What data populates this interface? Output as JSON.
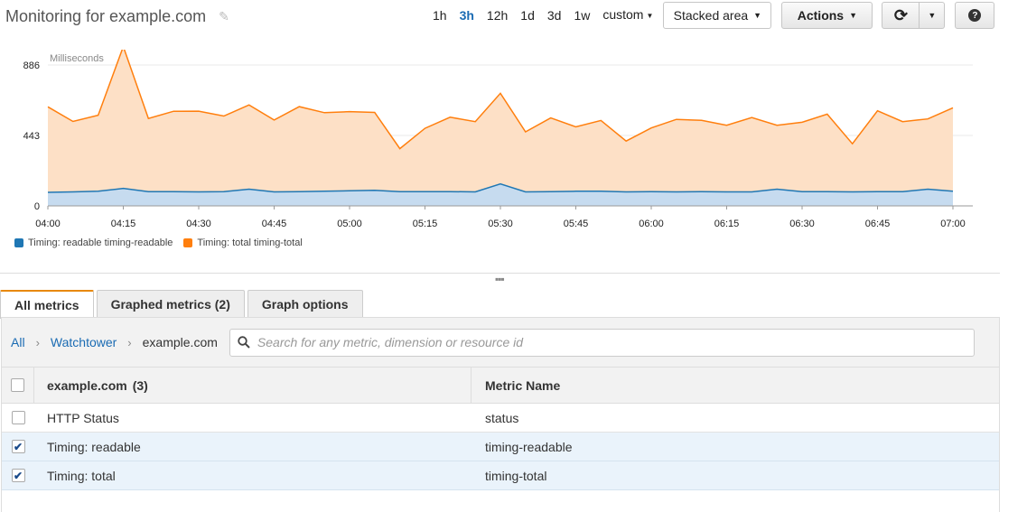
{
  "header": {
    "title": "Monitoring for example.com",
    "ranges": [
      "1h",
      "3h",
      "12h",
      "1d",
      "3d",
      "1w"
    ],
    "active_range": "3h",
    "custom_label": "custom",
    "chart_type_label": "Stacked area",
    "actions_label": "Actions",
    "icons": {
      "edit": "pencil-icon",
      "refresh": "refresh-icon",
      "help": "help-icon"
    }
  },
  "chart_data": {
    "type": "area",
    "stacked": true,
    "ylabel": "Milliseconds",
    "ylim": [
      0,
      886
    ],
    "yticks": [
      0,
      443,
      886
    ],
    "x_ticks": [
      "04:00",
      "04:15",
      "04:30",
      "04:45",
      "05:00",
      "05:15",
      "05:30",
      "05:45",
      "06:00",
      "06:15",
      "06:30",
      "06:45",
      "07:00"
    ],
    "grid": true,
    "legend_position": "bottom-left",
    "series": [
      {
        "name": "Timing: readable timing-readable",
        "color": "#1f77b4",
        "values": [
          85,
          88,
          92,
          110,
          90,
          90,
          88,
          90,
          105,
          88,
          90,
          92,
          95,
          98,
          90,
          90,
          90,
          88,
          138,
          88,
          90,
          92,
          92,
          88,
          90,
          88,
          90,
          88,
          88,
          105,
          90,
          90,
          88,
          90,
          90,
          105,
          92
        ]
      },
      {
        "name": "Timing: total timing-total",
        "color": "#ff7f0e",
        "values": [
          538,
          443,
          478,
          892,
          460,
          505,
          508,
          475,
          530,
          452,
          534,
          494,
          498,
          490,
          270,
          398,
          468,
          442,
          570,
          378,
          463,
          405,
          445,
          320,
          400,
          456,
          448,
          419,
          468,
          402,
          436,
          487,
          303,
          508,
          440,
          442,
          525
        ]
      }
    ]
  },
  "tabs": [
    {
      "label": "All metrics",
      "active": true
    },
    {
      "label": "Graphed metrics (2)",
      "active": false
    },
    {
      "label": "Graph options",
      "active": false
    }
  ],
  "breadcrumb": {
    "items": [
      "All",
      "Watchtower"
    ],
    "current": "example.com",
    "separator": "›"
  },
  "search": {
    "placeholder": "Search for any metric, dimension or resource id"
  },
  "table": {
    "headers": {
      "name": "example.com",
      "count": "(3)",
      "metric": "Metric Name"
    },
    "rows": [
      {
        "name": "HTTP Status",
        "metric": "status",
        "checked": false
      },
      {
        "name": "Timing: readable",
        "metric": "timing-readable",
        "checked": true
      },
      {
        "name": "Timing: total",
        "metric": "timing-total",
        "checked": true
      }
    ]
  }
}
